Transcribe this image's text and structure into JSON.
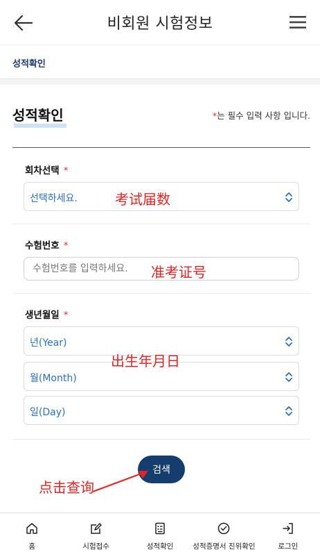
{
  "header": {
    "title": "비회원 시험정보",
    "back_icon": "arrow-left-icon",
    "menu_icon": "hamburger-menu-icon"
  },
  "breadcrumb": "성적확인",
  "page": {
    "title": "성적확인",
    "required_star": "*",
    "required_note": "는 필수 입력 사항 입니다."
  },
  "form": {
    "round": {
      "label": "회차선택",
      "star": "*",
      "value": "선택하세요."
    },
    "exam_number": {
      "label": "수험번호",
      "star": "*",
      "placeholder": "수험번호를 입력하세요."
    },
    "birth": {
      "label": "생년월일",
      "star": "*",
      "year": "년(Year)",
      "month": "월(Month)",
      "day": "일(Day)"
    },
    "search_button": "검색"
  },
  "annotations": {
    "round": "考试届数",
    "exam_number": "准考证号",
    "birth": "出生年月日",
    "search": "点击查询",
    "color": "#e32424"
  },
  "bottom_nav": [
    {
      "label": "홈",
      "icon": "home-icon"
    },
    {
      "label": "시험접수",
      "icon": "edit-icon"
    },
    {
      "label": "성적확인",
      "icon": "document-list-icon"
    },
    {
      "label": "성적증명서 진위확인",
      "icon": "check-circle-icon"
    },
    {
      "label": "로그인",
      "icon": "login-icon"
    }
  ],
  "colors": {
    "primary": "#153e6e",
    "breadcrumb": "#1e3a6e",
    "select_text": "#2a6fc0",
    "required": "#e0302f"
  }
}
